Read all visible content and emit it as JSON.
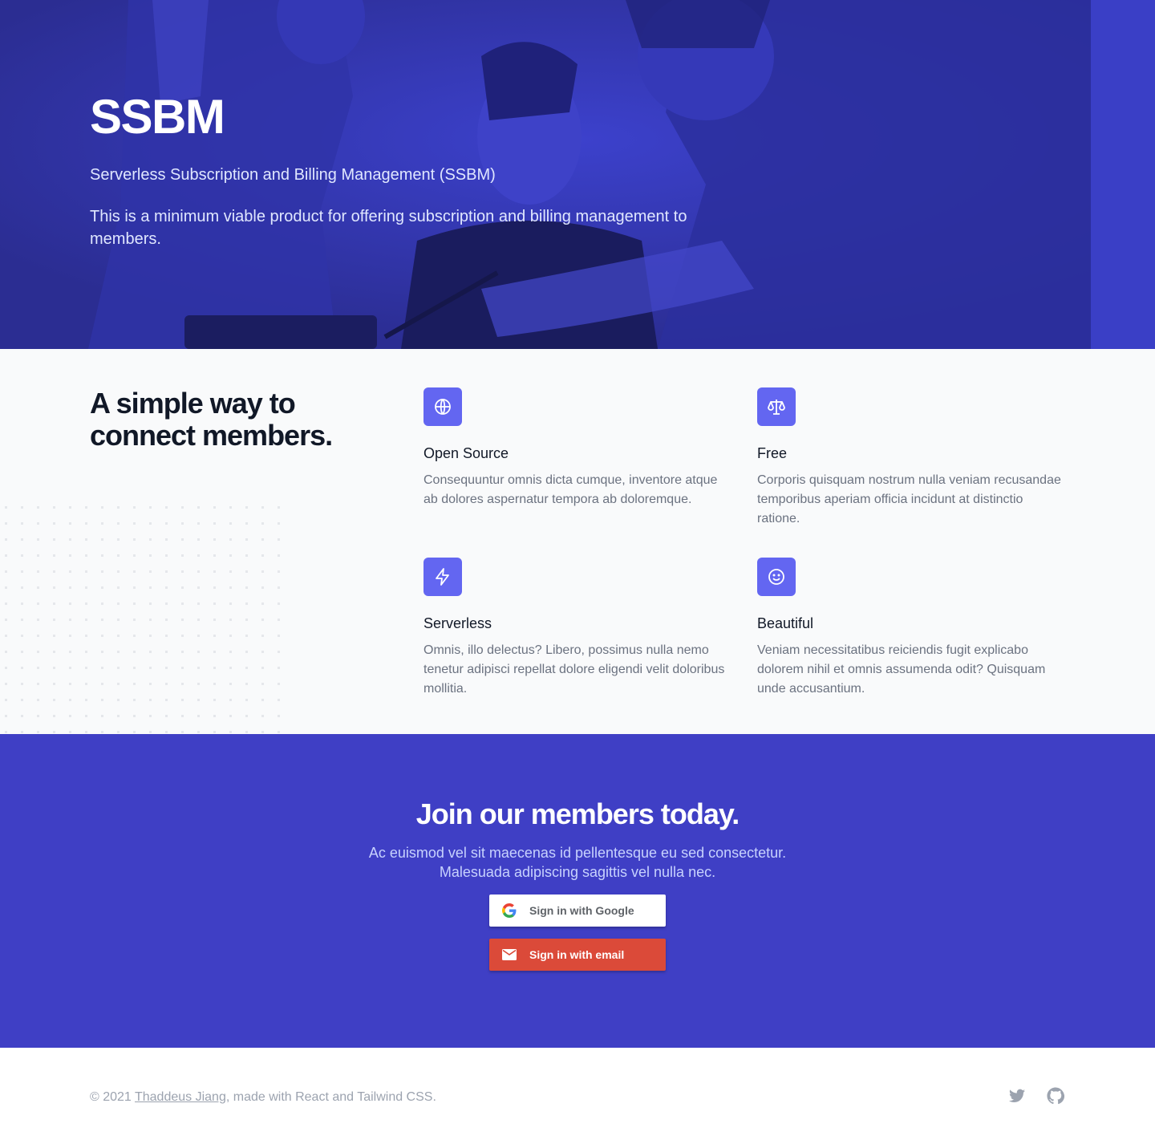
{
  "hero": {
    "title": "SSBM",
    "subtitle": "Serverless Subscription and Billing Management (SSBM)",
    "description": "This is a minimum viable product for offering subscription and billing management to members."
  },
  "features": {
    "heading": "A simple way to connect members.",
    "items": [
      {
        "icon": "globe-icon",
        "title": "Open Source",
        "description": "Consequuntur omnis dicta cumque, inventore atque ab dolores aspernatur tempora ab doloremque."
      },
      {
        "icon": "scale-icon",
        "title": "Free",
        "description": "Corporis quisquam nostrum nulla veniam recusandae temporibus aperiam officia incidunt at distinctio ratione."
      },
      {
        "icon": "lightning-icon",
        "title": "Serverless",
        "description": "Omnis, illo delectus? Libero, possimus nulla nemo tenetur adipisci repellat dolore eligendi velit doloribus mollitia."
      },
      {
        "icon": "smile-icon",
        "title": "Beautiful",
        "description": "Veniam necessitatibus reiciendis fugit explicabo dolorem nihil et omnis assumenda odit? Quisquam unde accusantium."
      }
    ]
  },
  "cta": {
    "title": "Join our members today.",
    "description": "Ac euismod vel sit maecenas id pellentesque eu sed consectetur. Malesuada adipiscing sagittis vel nulla nec.",
    "google_button": "Sign in with Google",
    "email_button": "Sign in with email"
  },
  "footer": {
    "copyright": "© 2021",
    "author": "Thaddeus Jiang",
    "suffix": ", made with React and Tailwind CSS.",
    "social": [
      "twitter-icon",
      "github-icon"
    ]
  },
  "colors": {
    "hero_overlay": "#3337b6",
    "feature_icon_bg": "#6366f1",
    "cta_bg": "#3f3fc5",
    "email_button": "#db4a39"
  }
}
